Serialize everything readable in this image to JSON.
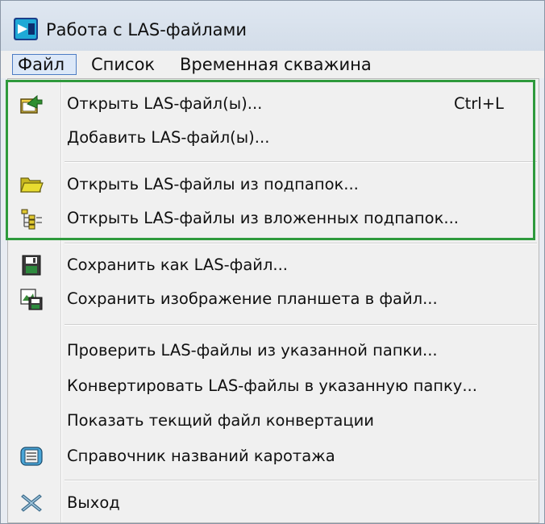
{
  "window": {
    "title": "Работа с LAS-файлами"
  },
  "menubar": {
    "items": [
      {
        "label": "Файл"
      },
      {
        "label": "Список"
      },
      {
        "label": "Временная скважина"
      }
    ]
  },
  "file_menu": {
    "items": [
      {
        "label": "Открыть LAS-файл(ы)...",
        "shortcut": "Ctrl+L",
        "icon": "open-file-icon"
      },
      {
        "label": "Добавить LAS-файл(ы)...",
        "icon": ""
      },
      {
        "label": "Открыть LAS-файлы из подпапок...",
        "icon": "folder-icon"
      },
      {
        "label": "Открыть LAS-файлы из вложенных подпапок...",
        "icon": "tree-icon"
      },
      {
        "label": "Сохранить как LAS-файл...",
        "icon": "save-icon"
      },
      {
        "label": "Сохранить изображение планшета в файл...",
        "icon": "save-image-icon"
      },
      {
        "label": "Проверить LAS-файлы из указанной папки...",
        "icon": ""
      },
      {
        "label": "Конвертировать LAS-файлы в указанную папку...",
        "icon": ""
      },
      {
        "label": "Показать текщий файл конвертации",
        "icon": ""
      },
      {
        "label": "Справочник названий каротажа",
        "icon": "dictionary-icon"
      },
      {
        "label": "Выход",
        "icon": "exit-icon"
      }
    ]
  },
  "colors": {
    "highlight_border": "#2e9a3c",
    "menu_background": "#f0f0f0",
    "active_menu_border": "#4d7cc4"
  }
}
